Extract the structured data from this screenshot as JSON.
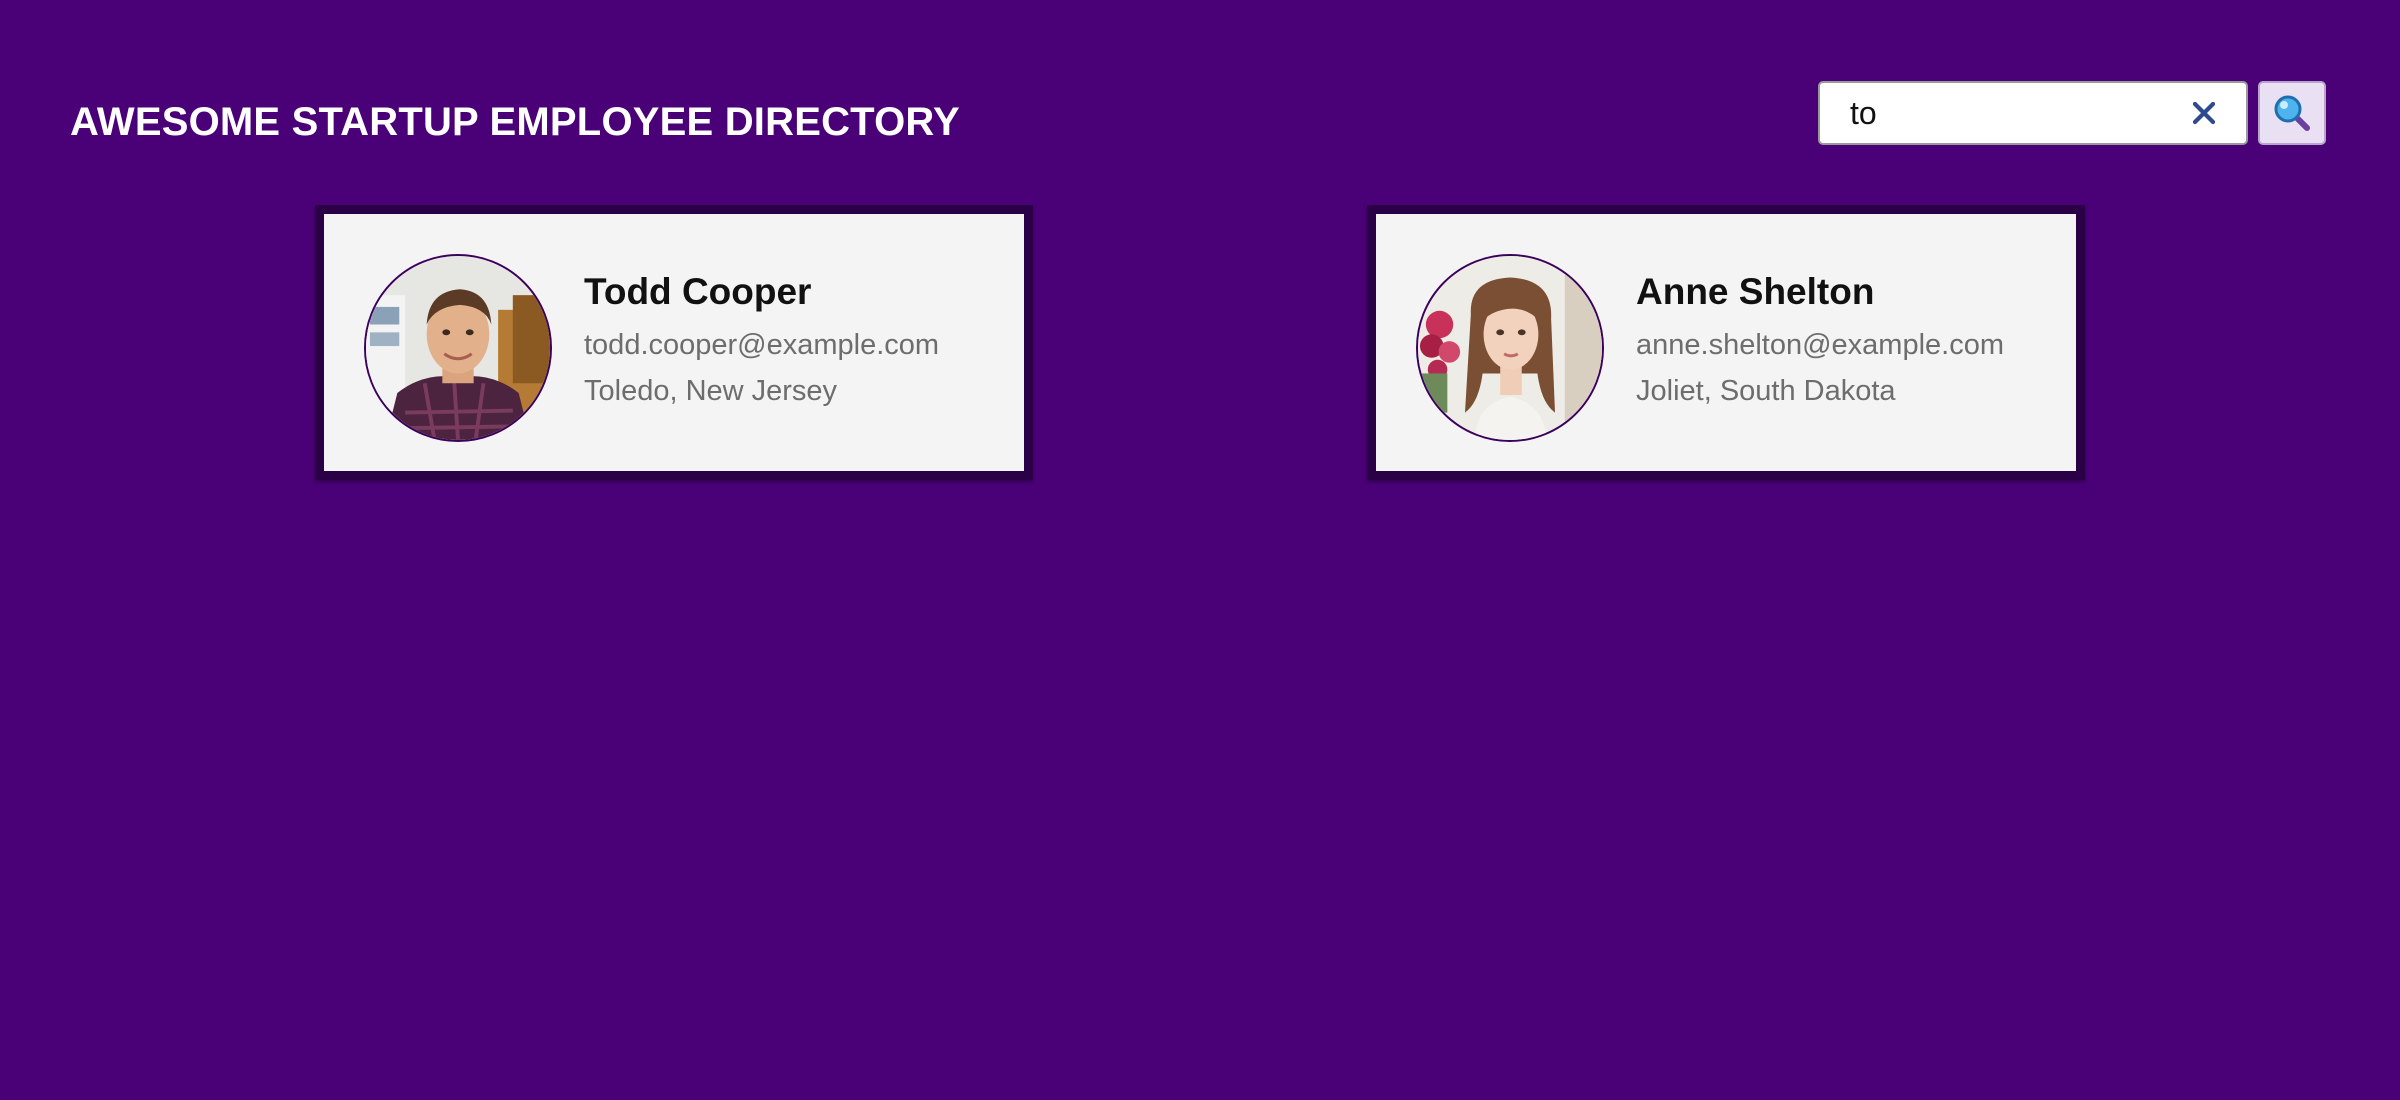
{
  "header": {
    "title": "AWESOME STARTUP EMPLOYEE DIRECTORY"
  },
  "search": {
    "value": "to",
    "clear_icon": "close-icon",
    "submit_icon": "search-icon"
  },
  "colors": {
    "background": "#4a0077",
    "card_border": "#2a0046",
    "card_background": "#f4f4f4",
    "secondary_text": "#6d6d6d"
  },
  "employees": [
    {
      "name": "Todd Cooper",
      "email": "todd.cooper@example.com",
      "location": "Toledo, New Jersey",
      "avatar_icon": "employee-photo-icon"
    },
    {
      "name": "Anne Shelton",
      "email": "anne.shelton@example.com",
      "location": "Joliet, South Dakota",
      "avatar_icon": "employee-photo-icon"
    }
  ]
}
